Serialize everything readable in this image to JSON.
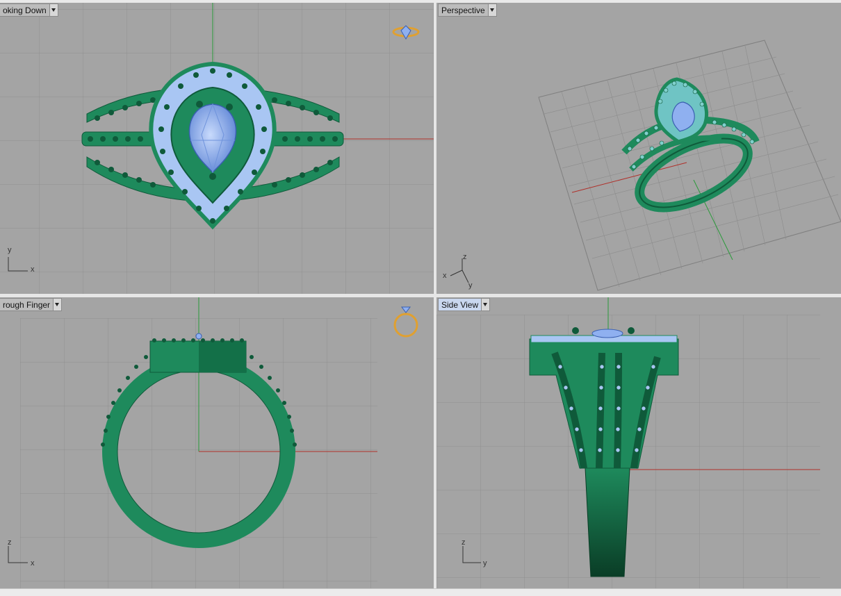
{
  "viewports": {
    "top_left": {
      "label": "oking Down"
    },
    "top_right": {
      "label": "Perspective"
    },
    "bottom_left": {
      "label": "rough Finger"
    },
    "bottom_right": {
      "label": "Side View"
    }
  },
  "axes": {
    "top_left": {
      "v": "y",
      "h": "x"
    },
    "top_right": {
      "z": "z",
      "x": "x",
      "y": "y"
    },
    "bottom_left": {
      "v": "z",
      "h": "x"
    },
    "bottom_right": {
      "v": "z",
      "h": "y"
    }
  },
  "colors": {
    "viewport_bg": "#a4a4a4",
    "grid": "#8f8f8f",
    "metal": "#1e8a5c",
    "metal_dark": "#0f5a3a",
    "gem": "#8fb0f0",
    "pave": "#a9c6f3",
    "x_axis": "#b0302a",
    "y_axis": "#2a9a3a",
    "active_tab": "#c9d7ef",
    "gizmo": "#e0a030"
  },
  "icons": {
    "top_gizmo": "ring-top-view-gizmo-icon",
    "front_gizmo": "ring-front-view-gizmo-icon"
  }
}
